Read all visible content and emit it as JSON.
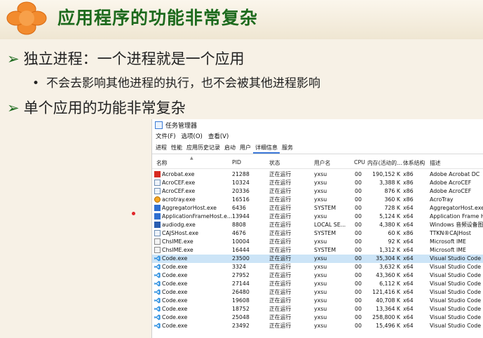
{
  "slide": {
    "title": "应用程序的功能非常复杂",
    "bullets": [
      "独立进程：一个进程就是一个应用",
      "单个应用的功能非常复杂"
    ],
    "sub_bullet": "不会去影响其他进程的执行，也不会被其他进程影响"
  },
  "task_manager": {
    "title": "任务管理器",
    "menu": [
      "文件(F)",
      "选项(O)",
      "查看(V)"
    ],
    "tabs": [
      "进程",
      "性能",
      "应用历史记录",
      "启动",
      "用户",
      "详细信息",
      "服务"
    ],
    "active_tab": "详细信息",
    "columns": {
      "name": "名称",
      "pid": "PID",
      "status": "状态",
      "user": "用户名",
      "cpu": "CPU",
      "memory": "内存(活动的...",
      "arch": "体系结构",
      "desc": "描述"
    },
    "rows": [
      {
        "icon": "acrobat-icon",
        "name": "Acrobat.exe",
        "pid": "21288",
        "status": "正在运行",
        "user": "yxsu",
        "cpu": "00",
        "mem": "190,152 K",
        "arch": "x86",
        "desc": "Adobe Acrobat DC"
      },
      {
        "icon": "window-icon",
        "name": "AcroCEF.exe",
        "pid": "10324",
        "status": "正在运行",
        "user": "yxsu",
        "cpu": "00",
        "mem": "3,388 K",
        "arch": "x86",
        "desc": "Adobe AcroCEF"
      },
      {
        "icon": "window-icon",
        "name": "AcroCEF.exe",
        "pid": "20336",
        "status": "正在运行",
        "user": "yxsu",
        "cpu": "00",
        "mem": "876 K",
        "arch": "x86",
        "desc": "Adobe AcroCEF"
      },
      {
        "icon": "acrotray-icon",
        "name": "acrotray.exe",
        "pid": "16516",
        "status": "正在运行",
        "user": "yxsu",
        "cpu": "00",
        "mem": "360 K",
        "arch": "x86",
        "desc": "AcroTray"
      },
      {
        "icon": "app-icon",
        "name": "AggregatorHost.exe",
        "pid": "6436",
        "status": "正在运行",
        "user": "SYSTEM",
        "cpu": "00",
        "mem": "728 K",
        "arch": "x64",
        "desc": "AggregatorHost.exe"
      },
      {
        "icon": "app-icon",
        "name": "ApplicationFrameHost.e...",
        "pid": "13944",
        "status": "正在运行",
        "user": "yxsu",
        "cpu": "00",
        "mem": "5,124 K",
        "arch": "x64",
        "desc": "Application Frame Ho"
      },
      {
        "icon": "audio-icon",
        "name": "audiodg.exe",
        "pid": "8808",
        "status": "正在运行",
        "user": "LOCAL SE...",
        "cpu": "00",
        "mem": "4,380 K",
        "arch": "x64",
        "desc": "Windows 音频设备图"
      },
      {
        "icon": "window-icon",
        "name": "CAJSHost.exe",
        "pid": "4676",
        "status": "正在运行",
        "user": "SYSTEM",
        "cpu": "00",
        "mem": "60 K",
        "arch": "x86",
        "desc": "TTKN®CAJHost"
      },
      {
        "icon": "ime-icon",
        "name": "ChsIME.exe",
        "pid": "10004",
        "status": "正在运行",
        "user": "yxsu",
        "cpu": "00",
        "mem": "92 K",
        "arch": "x64",
        "desc": "Microsoft IME"
      },
      {
        "icon": "ime-icon",
        "name": "ChsIME.exe",
        "pid": "16444",
        "status": "正在运行",
        "user": "SYSTEM",
        "cpu": "00",
        "mem": "1,312 K",
        "arch": "x64",
        "desc": "Microsoft IME"
      },
      {
        "icon": "vscode-icon",
        "name": "Code.exe",
        "pid": "23500",
        "status": "正在运行",
        "user": "yxsu",
        "cpu": "00",
        "mem": "35,304 K",
        "arch": "x64",
        "desc": "Visual Studio Code",
        "selected": true
      },
      {
        "icon": "vscode-icon",
        "name": "Code.exe",
        "pid": "3324",
        "status": "正在运行",
        "user": "yxsu",
        "cpu": "00",
        "mem": "3,632 K",
        "arch": "x64",
        "desc": "Visual Studio Code"
      },
      {
        "icon": "vscode-icon",
        "name": "Code.exe",
        "pid": "27952",
        "status": "正在运行",
        "user": "yxsu",
        "cpu": "00",
        "mem": "43,360 K",
        "arch": "x64",
        "desc": "Visual Studio Code"
      },
      {
        "icon": "vscode-icon",
        "name": "Code.exe",
        "pid": "27144",
        "status": "正在运行",
        "user": "yxsu",
        "cpu": "00",
        "mem": "6,112 K",
        "arch": "x64",
        "desc": "Visual Studio Code"
      },
      {
        "icon": "vscode-icon",
        "name": "Code.exe",
        "pid": "26480",
        "status": "正在运行",
        "user": "yxsu",
        "cpu": "00",
        "mem": "121,416 K",
        "arch": "x64",
        "desc": "Visual Studio Code"
      },
      {
        "icon": "vscode-icon",
        "name": "Code.exe",
        "pid": "19608",
        "status": "正在运行",
        "user": "yxsu",
        "cpu": "00",
        "mem": "40,708 K",
        "arch": "x64",
        "desc": "Visual Studio Code"
      },
      {
        "icon": "vscode-icon",
        "name": "Code.exe",
        "pid": "18752",
        "status": "正在运行",
        "user": "yxsu",
        "cpu": "00",
        "mem": "13,364 K",
        "arch": "x64",
        "desc": "Visual Studio Code"
      },
      {
        "icon": "vscode-icon",
        "name": "Code.exe",
        "pid": "25048",
        "status": "正在运行",
        "user": "yxsu",
        "cpu": "00",
        "mem": "258,800 K",
        "arch": "x64",
        "desc": "Visual Studio Code"
      },
      {
        "icon": "vscode-icon",
        "name": "Code.exe",
        "pid": "23492",
        "status": "正在运行",
        "user": "yxsu",
        "cpu": "00",
        "mem": "15,496 K",
        "arch": "x64",
        "desc": "Visual Studio Code"
      }
    ]
  }
}
